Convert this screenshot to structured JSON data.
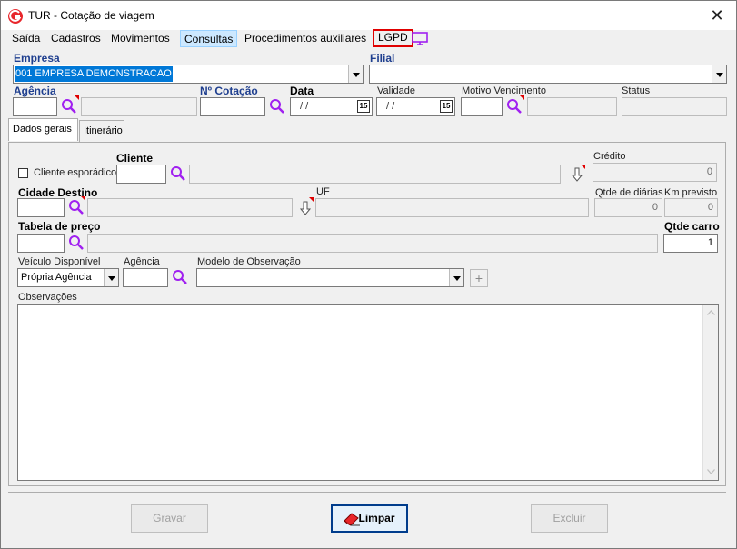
{
  "window": {
    "title": "TUR - Cotação de viagem",
    "close": "✕"
  },
  "menu": {
    "items": [
      "Saída",
      "Cadastros",
      "Movimentos",
      "Consultas",
      "Procedimentos auxiliares",
      "LGPD"
    ]
  },
  "header": {
    "empresa_label": "Empresa",
    "empresa_value": "001 EMPRESA DEMONSTRACAO",
    "filial_label": "Filial",
    "agencia_label": "Agência",
    "cotacao_label": "Nº Cotação",
    "data_label": "Data",
    "data_value": "/ /",
    "validade_label": "Validade",
    "validade_value": "/ /",
    "motivo_label": "Motivo Vencimento",
    "status_label": "Status",
    "cal_label": "15"
  },
  "tabs": {
    "dados_gerais": "Dados gerais",
    "itinerario": "Itinerário"
  },
  "form": {
    "cliente_esporadico": "Cliente esporádico",
    "cliente_label": "Cliente",
    "credito_label": "Crédito",
    "credito_value": "0",
    "cidade_destino_label": "Cidade Destino",
    "uf_label": "UF",
    "qtde_diarias_label": "Qtde de diárias",
    "qtde_diarias_value": "0",
    "km_previsto_label": "Km previsto",
    "km_previsto_value": "0",
    "tabela_preco_label": "Tabela de preço",
    "qtde_carro_label": "Qtde carro",
    "qtde_carro_value": "1",
    "veiculo_label": "Veículo Disponível",
    "veiculo_value": "Própria Agência",
    "agencia_label": "Agência",
    "modelo_obs_label": "Modelo de Observação",
    "observacoes_label": "Observações",
    "plus": "+"
  },
  "buttons": {
    "gravar": "Gravar",
    "limpar": "Limpar",
    "excluir": "Excluir"
  },
  "colors": {
    "selection": "#0078d7",
    "lgpd_border": "#e00000",
    "icon_purple": "#a020f0",
    "required_mark": "#e00000"
  }
}
